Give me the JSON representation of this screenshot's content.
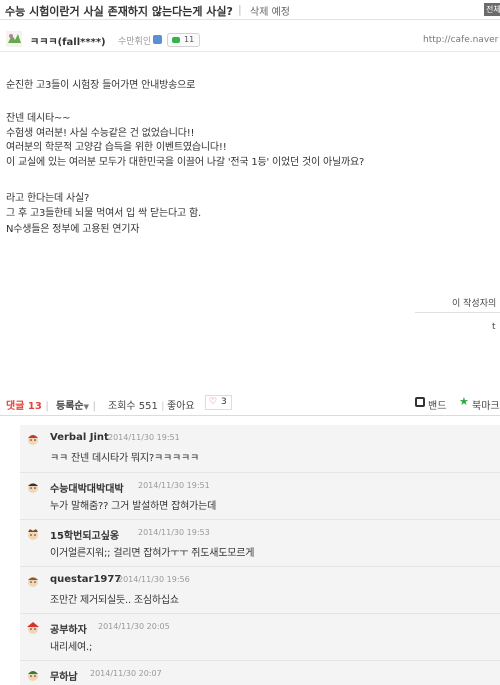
{
  "post": {
    "title": "수능 시험이란거 사실 존재하지 않는다는게 사실?",
    "separator": "|",
    "delete_label": "삭제 예정",
    "corner_tab": "전체"
  },
  "author": {
    "nickname": "ㅋㅋㅋ(fall****)",
    "grade": "수만휘인",
    "comment_count": "11",
    "url": "http://cafe.naver"
  },
  "body": {
    "lines": [
      "순진한 고3들이 시험장 들어가면 안내방송으로",
      "잔넨 데시타~~",
      "수험생 여러분! 사실 수능같은 건 없었습니다!!",
      "여러분의 학문적 고양감 습득을 위한 이벤트였습니다!!",
      "이 교실에 있는 여러분 모두가 대한민국을 이끌어 나갈 '전국 1등' 이었던 것이 아닐까요?",
      "라고 한다는데 사실?",
      "그 후 고3들한테 뇌물 먹여서 입 싹 닫는다고 함.",
      "N수생들은 정부에 고용된 연기자"
    ]
  },
  "footer": {
    "author_posts": "이 작성자의",
    "mark": "t"
  },
  "stats": {
    "comments_label": "댓글 13",
    "sort_label": "등록순",
    "views_label": "조회수 551",
    "likes_label": "좋아요",
    "likes_count": "3",
    "band_label": "밴드",
    "bookmark_label": "북마크"
  },
  "comments": [
    {
      "nick": "Verbal Jint",
      "date": "2014/11/30 19:51",
      "text": "ㅋㅋ 잔넨 데시타가 뭐지?ㅋㅋㅋㅋㅋ"
    },
    {
      "nick": "수능대박대박대박",
      "date": "2014/11/30 19:51",
      "text": "누가 말해줌?? 그거 발설하면 잡혀가는데"
    },
    {
      "nick": "15학번되고싶옹",
      "date": "2014/11/30 19:53",
      "text": "이거얼른지워;; 걸리면 잡혀가ㅜㅜ 쥐도새도모르게"
    },
    {
      "nick": "questar1977",
      "date": "2014/11/30 19:56",
      "text": "조만간 제거되실듯.. 조심하십쇼"
    },
    {
      "nick": "공부하자",
      "date": "2014/11/30 20:05",
      "text": "내리세여.;"
    },
    {
      "nick": "무하남",
      "date": "2014/11/30 20:07",
      "text": ""
    }
  ],
  "colors": {
    "accent_red": "#e0453a",
    "chip_green": "#35b44a",
    "comment_bg": "#f4f4f4"
  }
}
